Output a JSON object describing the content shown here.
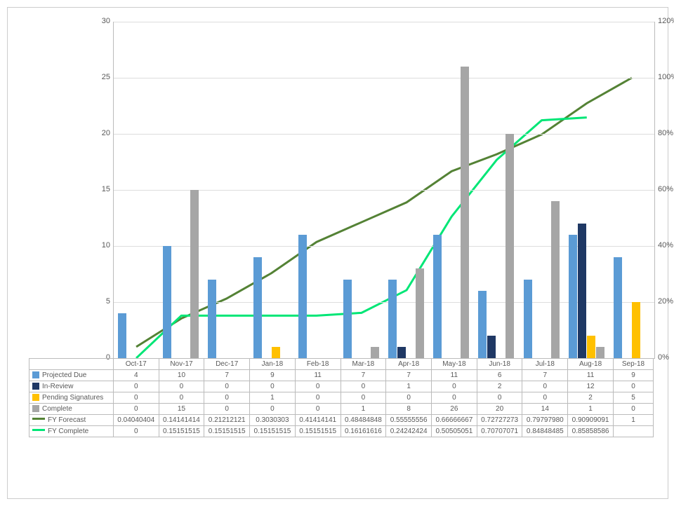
{
  "chart_data": {
    "type": "bar",
    "categories": [
      "Oct-17",
      "Nov-17",
      "Dec-17",
      "Jan-18",
      "Feb-18",
      "Mar-18",
      "Apr-18",
      "May-18",
      "Jun-18",
      "Jul-18",
      "Aug-18",
      "Sep-18"
    ],
    "series": [
      {
        "name": "Projected Due",
        "type": "bar",
        "color": "#5B9BD5",
        "values": [
          4,
          10,
          7,
          9,
          11,
          7,
          7,
          11,
          6,
          7,
          11,
          9
        ]
      },
      {
        "name": "In-Review",
        "type": "bar",
        "color": "#1F3864",
        "values": [
          0,
          0,
          0,
          0,
          0,
          0,
          1,
          0,
          2,
          0,
          12,
          0
        ]
      },
      {
        "name": "Pending Signatures",
        "type": "bar",
        "color": "#FFC000",
        "values": [
          0,
          0,
          0,
          1,
          0,
          0,
          0,
          0,
          0,
          0,
          2,
          5
        ]
      },
      {
        "name": "Complete",
        "type": "bar",
        "color": "#A6A6A6",
        "values": [
          0,
          15,
          0,
          0,
          0,
          1,
          8,
          26,
          20,
          14,
          1,
          0
        ]
      },
      {
        "name": "FY Forecast",
        "type": "line",
        "color": "#548235",
        "values": [
          0.04040404,
          0.141414141,
          0.212121212,
          0.303030303,
          0.414141414,
          0.484848485,
          0.555555556,
          0.666666667,
          0.727272727,
          0.797979798,
          0.909090909,
          1
        ],
        "display": [
          "0.04040404",
          "0.14141414",
          "0.21212121",
          "0.3030303",
          "0.41414141",
          "0.48484848",
          "0.55555556",
          "0.66666667",
          "0.72727273",
          "0.79797980",
          "0.90909091",
          "1"
        ]
      },
      {
        "name": "FY Complete",
        "type": "line",
        "color": "#00E676",
        "values": [
          0,
          0.151515152,
          0.151515152,
          0.151515152,
          0.151515152,
          0.161616162,
          0.242424242,
          0.505050505,
          0.707070707,
          0.848484848,
          0.858585859,
          null
        ],
        "display": [
          "0",
          "0.15151515",
          "0.15151515",
          "0.15151515",
          "0.15151515",
          "0.16161616",
          "0.24242424",
          "0.50505051",
          "0.70707071",
          "0.84848485",
          "0.85858586",
          ""
        ]
      }
    ],
    "y_left": {
      "min": 0,
      "max": 30,
      "step": 5,
      "ticks": [
        0,
        5,
        10,
        15,
        20,
        25,
        30
      ]
    },
    "y_right": {
      "min": 0,
      "max": 1.2,
      "step": 0.2,
      "ticks": [
        "0%",
        "20%",
        "40%",
        "60%",
        "80%",
        "100%",
        "120%"
      ]
    }
  },
  "table_headers": [
    "Oct-17",
    "Nov-17",
    "Dec-17",
    "Jan-18",
    "Feb-18",
    "Mar-18",
    "Apr-18",
    "May-18",
    "Jun-18",
    "Jul-18",
    "Aug-18",
    "Sep-18"
  ]
}
